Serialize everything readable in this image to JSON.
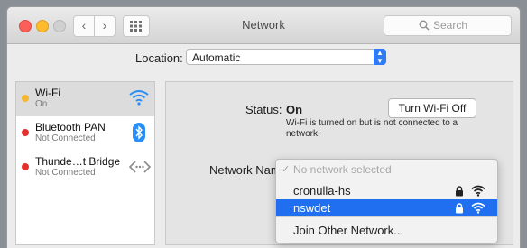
{
  "window": {
    "title": "Network",
    "search_placeholder": "Search"
  },
  "location": {
    "label": "Location:",
    "value": "Automatic"
  },
  "services": [
    {
      "name": "Wi-Fi",
      "status": "On",
      "dot_color": "#f5b731",
      "icon": "wifi-icon"
    },
    {
      "name": "Bluetooth PAN",
      "status": "Not Connected",
      "dot_color": "#e0322c",
      "icon": "bluetooth-icon"
    },
    {
      "name": "Thunde…t Bridge",
      "status": "Not Connected",
      "dot_color": "#e0322c",
      "icon": "thunderbolt-bridge-icon"
    }
  ],
  "wifi_panel": {
    "status_label": "Status:",
    "status_value": "On",
    "turn_off_button": "Turn Wi-Fi Off",
    "status_description": "Wi-Fi is turned on but is not connected to a network.",
    "network_name_label": "Network Name"
  },
  "network_menu": {
    "items": [
      {
        "label": "No network selected",
        "checked": true,
        "disabled": true
      },
      {
        "label": "cronulla-hs",
        "locked": true,
        "highlighted": false
      },
      {
        "label": "nswdet",
        "locked": true,
        "highlighted": true
      }
    ],
    "join_other": "Join Other Network..."
  },
  "colors": {
    "accent": "#1f6ff0",
    "select_arrow": "#2f7bf5"
  }
}
